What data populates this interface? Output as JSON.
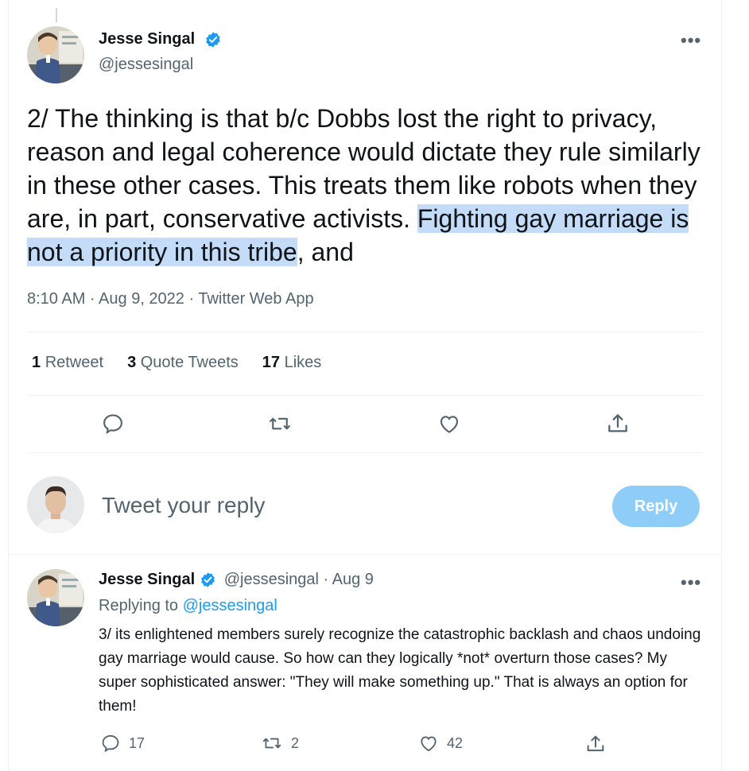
{
  "main_tweet": {
    "author_name": "Jesse Singal",
    "author_handle": "@jessesingal",
    "text_before": "2/ The thinking is that b/c Dobbs lost the right to privacy, reason and legal coherence would dictate they rule similarly in these other cases. This treats them like robots when they are, in part, conservative activists. ",
    "text_highlighted": "Fighting gay marriage is not a priority in this tribe",
    "text_after": ", and",
    "meta": "8:10 AM · Aug 9, 2022 · Twitter Web App",
    "stats": {
      "retweets_count": "1",
      "retweets_label": "Retweet",
      "quotes_count": "3",
      "quotes_label": "Quote Tweets",
      "likes_count": "17",
      "likes_label": "Likes"
    }
  },
  "reply_box": {
    "placeholder": "Tweet your reply",
    "button_label": "Reply"
  },
  "reply_tweet": {
    "author_name": "Jesse Singal",
    "author_handle_date": "@jessesingal · Aug 9",
    "replying_prefix": "Replying to",
    "replying_handle": "@jessesingal",
    "text": "3/ its enlightened members surely recognize the catastrophic backlash and chaos undoing gay marriage would cause. So how can they logically *not* overturn those cases? My super sophisticated answer: \"They will make something up.\" That is always an option for them!",
    "reply_count": "17",
    "retweet_count": "2",
    "like_count": "42"
  },
  "more_label": "•••",
  "colors": {
    "accent": "#1d9bf0",
    "highlight": "#c4dcf7",
    "reply_button": "#8ecdf8",
    "secondary_text": "#536471"
  },
  "icons": [
    "verified-badge-icon",
    "more-icon",
    "reply-icon",
    "retweet-icon",
    "like-icon",
    "share-icon"
  ]
}
